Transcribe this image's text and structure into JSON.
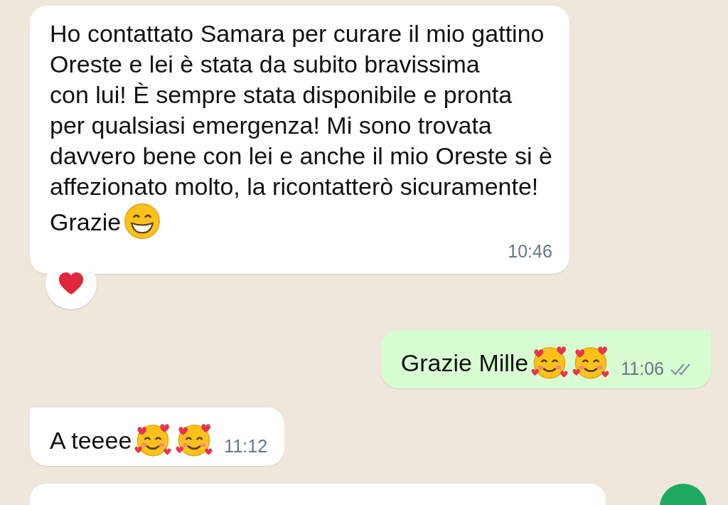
{
  "messages": [
    {
      "kind": "incoming",
      "text": "Ho contattato Samara per curare il mio gattino\nOreste e lei è stata da subito bravissima\ncon lui! È sempre stata disponibile e pronta\nper qualsiasi emergenza! Mi sono trovata\ndavvero bene con lei e anche il mio Oreste si è\naffezionato molto, la ricontatterò sicuramente!",
      "last_line": "Grazie",
      "emoji": [
        {
          "kind": "grin"
        }
      ],
      "time": "10:46",
      "tail": false,
      "reaction": {
        "kind": "heart"
      }
    },
    {
      "kind": "outgoing",
      "text": "Grazie Mille",
      "emoji": [
        {
          "kind": "hearts"
        },
        {
          "kind": "hearts"
        }
      ],
      "time": "11:06",
      "tail": true,
      "delivered": true
    },
    {
      "kind": "incoming",
      "text": "A teeee",
      "emoji": [
        {
          "kind": "hearts"
        },
        {
          "kind": "hearts"
        }
      ],
      "time": "11:12",
      "tail": true
    }
  ]
}
